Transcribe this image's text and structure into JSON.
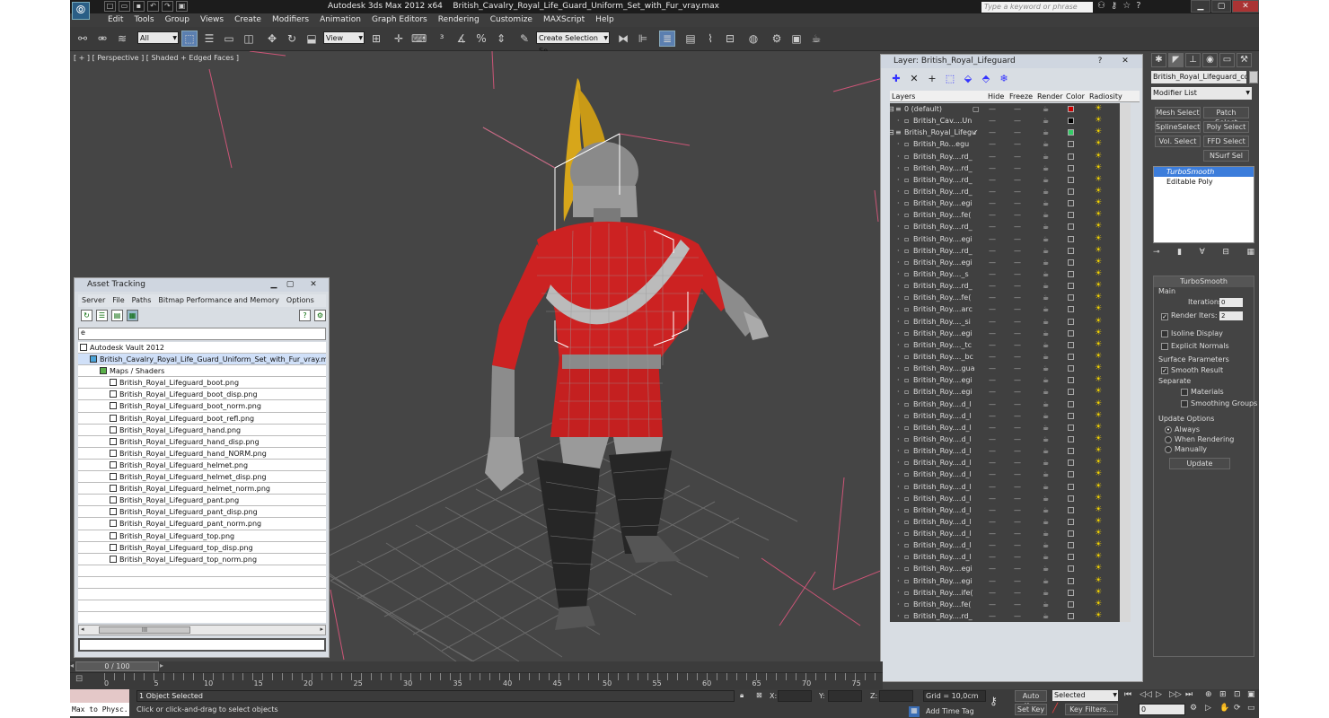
{
  "titlebar": {
    "app": "Autodesk 3ds Max  2012 x64",
    "file": "British_Cavalry_Royal_Life_Guard_Uniform_Set_with_Fur_vray.max",
    "search_placeholder": "Type a keyword or phrase"
  },
  "menu": [
    "Edit",
    "Tools",
    "Group",
    "Views",
    "Create",
    "Modifiers",
    "Animation",
    "Graph Editors",
    "Rendering",
    "Customize",
    "MAXScript",
    "Help"
  ],
  "toolbar": {
    "selection_filter": "All",
    "ref_coord": "View",
    "named_selection": "Create Selection Se"
  },
  "viewport": {
    "label": "[ + ] [ Perspective ] [ Shaded + Edged Faces ]"
  },
  "asset_tracking": {
    "title": "Asset Tracking",
    "menu": [
      "Server",
      "File",
      "Paths",
      "Bitmap Performance and Memory",
      "Options"
    ],
    "input_value": "e",
    "tree": [
      {
        "label": "Autodesk Vault 2012",
        "indent": 0
      },
      {
        "label": "British_Cavalry_Royal_Life_Guard_Uniform_Set_with_Fur_vray.max",
        "indent": 1
      },
      {
        "label": "Maps / Shaders",
        "indent": 2
      },
      {
        "label": "British_Royal_Lifeguard_boot.png",
        "indent": 3
      },
      {
        "label": "British_Royal_Lifeguard_boot_disp.png",
        "indent": 3
      },
      {
        "label": "British_Royal_Lifeguard_boot_norm.png",
        "indent": 3
      },
      {
        "label": "British_Royal_Lifeguard_boot_refl.png",
        "indent": 3
      },
      {
        "label": "British_Royal_Lifeguard_hand.png",
        "indent": 3
      },
      {
        "label": "British_Royal_Lifeguard_hand_disp.png",
        "indent": 3
      },
      {
        "label": "British_Royal_Lifeguard_hand_NORM.png",
        "indent": 3
      },
      {
        "label": "British_Royal_Lifeguard_helmet.png",
        "indent": 3
      },
      {
        "label": "British_Royal_Lifeguard_helmet_disp.png",
        "indent": 3
      },
      {
        "label": "British_Royal_Lifeguard_helmet_norm.png",
        "indent": 3
      },
      {
        "label": "British_Royal_Lifeguard_pant.png",
        "indent": 3
      },
      {
        "label": "British_Royal_Lifeguard_pant_disp.png",
        "indent": 3
      },
      {
        "label": "British_Royal_Lifeguard_pant_norm.png",
        "indent": 3
      },
      {
        "label": "British_Royal_Lifeguard_top.png",
        "indent": 3
      },
      {
        "label": "British_Royal_Lifeguard_top_disp.png",
        "indent": 3
      },
      {
        "label": "British_Royal_Lifeguard_top_norm.png",
        "indent": 3
      },
      {
        "label": "",
        "indent": 0
      },
      {
        "label": "",
        "indent": 0
      },
      {
        "label": "",
        "indent": 0
      },
      {
        "label": "",
        "indent": 0
      },
      {
        "label": "",
        "indent": 0
      }
    ],
    "scroll_thumb": "III"
  },
  "layer_panel": {
    "title": "Layer: British_Royal_Lifeguard",
    "columns": [
      "Layers",
      "Hide",
      "Freeze",
      "Render",
      "Color",
      "Radiosity"
    ],
    "rows": [
      {
        "name": "0 (default)",
        "level": 0,
        "color": "#cc0000"
      },
      {
        "name": "British_Cav....Un",
        "level": 1,
        "color": "#000000"
      },
      {
        "name": "British_Royal_Lifegu",
        "level": 0,
        "color": "#33cc66"
      },
      {
        "name": "British_Ro...egu",
        "level": 1
      },
      {
        "name": "British_Roy....rd_",
        "level": 1
      },
      {
        "name": "British_Roy....rd_",
        "level": 1
      },
      {
        "name": "British_Roy....rd_",
        "level": 1
      },
      {
        "name": "British_Roy....rd_",
        "level": 1
      },
      {
        "name": "British_Roy....egi",
        "level": 1
      },
      {
        "name": "British_Roy....fe(",
        "level": 1
      },
      {
        "name": "British_Roy....rd_",
        "level": 1
      },
      {
        "name": "British_Roy....egi",
        "level": 1
      },
      {
        "name": "British_Roy....rd_",
        "level": 1
      },
      {
        "name": "British_Roy....egi",
        "level": 1
      },
      {
        "name": "British_Roy...._s",
        "level": 1
      },
      {
        "name": "British_Roy....rd_",
        "level": 1
      },
      {
        "name": "British_Roy....fe(",
        "level": 1
      },
      {
        "name": "British_Roy....arc",
        "level": 1
      },
      {
        "name": "British_Roy...._si",
        "level": 1
      },
      {
        "name": "British_Roy....egi",
        "level": 1
      },
      {
        "name": "British_Roy...._tc",
        "level": 1
      },
      {
        "name": "British_Roy...._bc",
        "level": 1
      },
      {
        "name": "British_Roy....gua",
        "level": 1
      },
      {
        "name": "British_Roy....egi",
        "level": 1
      },
      {
        "name": "British_Roy....egi",
        "level": 1
      },
      {
        "name": "British_Roy....d_l",
        "level": 1
      },
      {
        "name": "British_Roy....d_l",
        "level": 1
      },
      {
        "name": "British_Roy....d_l",
        "level": 1
      },
      {
        "name": "British_Roy....d_l",
        "level": 1
      },
      {
        "name": "British_Roy....d_l",
        "level": 1
      },
      {
        "name": "British_Roy....d_l",
        "level": 1
      },
      {
        "name": "British_Roy....d_l",
        "level": 1
      },
      {
        "name": "British_Roy....d_l",
        "level": 1
      },
      {
        "name": "British_Roy....d_l",
        "level": 1
      },
      {
        "name": "British_Roy....d_l",
        "level": 1
      },
      {
        "name": "British_Roy....d_l",
        "level": 1
      },
      {
        "name": "British_Roy....d_l",
        "level": 1
      },
      {
        "name": "British_Roy....d_l",
        "level": 1
      },
      {
        "name": "British_Roy....d_l",
        "level": 1
      },
      {
        "name": "British_Roy....egi",
        "level": 1
      },
      {
        "name": "British_Roy....egi",
        "level": 1
      },
      {
        "name": "British_Roy....ife(",
        "level": 1
      },
      {
        "name": "British_Roy....fe(",
        "level": 1
      },
      {
        "name": "British_Roy....rd_",
        "level": 1
      }
    ]
  },
  "command_panel": {
    "object_name": "British_Royal_Lifeguard_cord",
    "modifier_list": "Modifier List",
    "mod_buttons": [
      "Mesh Select",
      "Patch Select",
      "SplineSelect",
      "Poly Select",
      "Vol. Select",
      "FFD Select",
      "NSurf Sel"
    ],
    "stack": [
      "TurboSmooth",
      "Editable Poly"
    ],
    "turbosmooth": {
      "title": "TurboSmooth",
      "main": "Main",
      "iterations_label": "Iterations:",
      "iterations": "0",
      "render_iters_label": "Render Iters:",
      "render_iters": "2",
      "isoline": "Isoline Display",
      "explicit": "Explicit Normals",
      "surface": "Surface Parameters",
      "smooth_result": "Smooth Result",
      "separate": "Separate",
      "materials": "Materials",
      "smoothing_groups": "Smoothing Groups",
      "update_options": "Update Options",
      "always": "Always",
      "when_rendering": "When Rendering",
      "manually": "Manually",
      "update": "Update"
    }
  },
  "time": {
    "slider": "0 / 100",
    "ticks": [
      "0",
      "5",
      "10",
      "15",
      "20",
      "25",
      "30",
      "35",
      "40",
      "45",
      "50",
      "55",
      "60",
      "65",
      "70",
      "75"
    ]
  },
  "status": {
    "maxscript": "Max to Physc.",
    "selected": "1 Object Selected",
    "prompt": "Click or click-and-drag to select objects",
    "x_label": "X:",
    "y_label": "Y:",
    "z_label": "Z:",
    "grid": "Grid = 10,0cm",
    "add_time_tag": "Add Time Tag",
    "auto_key": "Auto Key",
    "set_key": "Set Key",
    "selected_dropdown": "Selected",
    "key_filters": "Key Filters...",
    "frame": "0"
  },
  "colors": {
    "tunic": "#cc2222",
    "plume": "#d7a61a",
    "radiosity": "#f2d200",
    "selection": "#3c7ddb"
  }
}
